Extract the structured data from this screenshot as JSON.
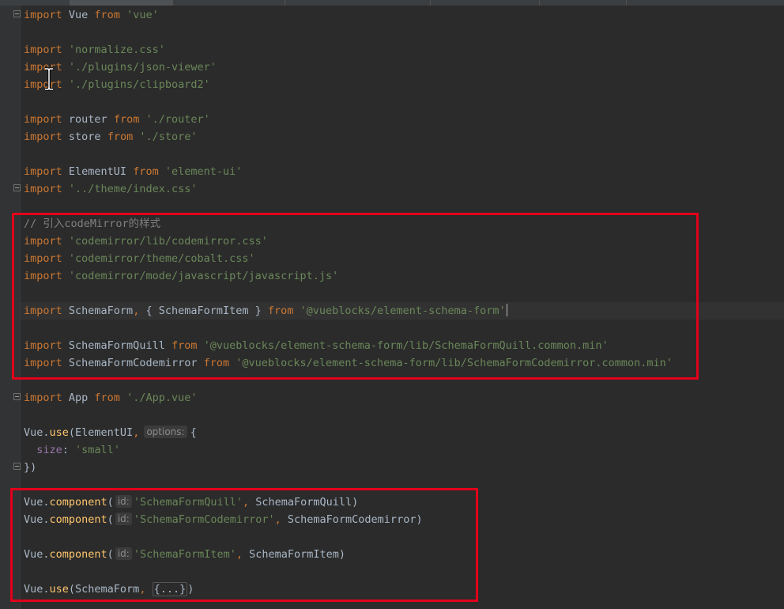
{
  "editor": {
    "lines": {
      "l1": {
        "kw": "import",
        "id": " Vue ",
        "kw2": "from",
        "str": " 'vue'"
      },
      "l3": {
        "kw": "import",
        "str": " 'normalize.css'"
      },
      "l4": {
        "kw": "import",
        "str": " './plugins/json-viewer'"
      },
      "l5": {
        "kw": "import",
        "str": " './plugins/clipboard2'"
      },
      "l7": {
        "kw": "import",
        "id": " router ",
        "kw2": "from",
        "str": " './router'"
      },
      "l8": {
        "kw": "import",
        "id": " store ",
        "kw2": "from",
        "str": " './store'"
      },
      "l10": {
        "kw": "import",
        "id": " ElementUI ",
        "kw2": "from",
        "str": " 'element-ui'"
      },
      "l11": {
        "kw": "import",
        "str": " '../theme/index.css'"
      },
      "l13": {
        "cmt": "// 引入codeMirror的样式"
      },
      "l14": {
        "kw": "import",
        "str": " 'codemirror/lib/codemirror.css'"
      },
      "l15": {
        "kw": "import",
        "str": " 'codemirror/theme/cobalt.css'"
      },
      "l16": {
        "kw": "import",
        "str": " 'codemirror/mode/javascript/javascript.js'"
      },
      "l18": {
        "kw": "import",
        "id": " SchemaForm",
        "punct": ",",
        "id2": " { SchemaFormItem } ",
        "kw2": "from",
        "str": " '@vueblocks/element-schema-form'"
      },
      "l20": {
        "kw": "import",
        "id": " SchemaFormQuill ",
        "kw2": "from",
        "str": " '@vueblocks/element-schema-form/lib/SchemaFormQuill.common.min'"
      },
      "l21": {
        "kw": "import",
        "id": " SchemaFormCodemirror ",
        "kw2": "from",
        "str": " '@vueblocks/element-schema-form/lib/SchemaFormCodemirror.common.min'"
      },
      "l23": {
        "kw": "import",
        "id": " App ",
        "kw2": "from",
        "str": " './App.vue'"
      },
      "l25": {
        "obj": "Vue.",
        "fn": "use",
        "open": "(ElementUI",
        "comma": ",",
        "hint": "options:",
        "rest": "{"
      },
      "l26": {
        "indent": "  ",
        "prop": "size",
        "colon": ": ",
        "str": "'small'"
      },
      "l27": {
        "text": "})"
      },
      "l29": {
        "obj": "Vue.",
        "fn": "component",
        "open": "(",
        "hint": "id:",
        "str": "'SchemaFormQuill'",
        "comma": ",",
        "rest": " SchemaFormQuill)"
      },
      "l30": {
        "obj": "Vue.",
        "fn": "component",
        "open": "(",
        "hint": "id:",
        "str": "'SchemaFormCodemirror'",
        "comma": ",",
        "rest": " SchemaFormCodemirror)"
      },
      "l32": {
        "obj": "Vue.",
        "fn": "component",
        "open": "(",
        "hint": "id:",
        "str": "'SchemaFormItem'",
        "comma": ",",
        "rest": " SchemaFormItem)"
      },
      "l34": {
        "obj": "Vue.",
        "fn": "use",
        "open": "(SchemaForm",
        "comma": ",",
        "folded": "{...}",
        "rest": ")"
      }
    }
  },
  "colors": {
    "background": "#2b2b2b",
    "keyword": "#cc7832",
    "string": "#6a8759",
    "function": "#ffc66d",
    "property": "#9876aa",
    "comment": "#808080",
    "highlight_box": "#e2001a"
  }
}
